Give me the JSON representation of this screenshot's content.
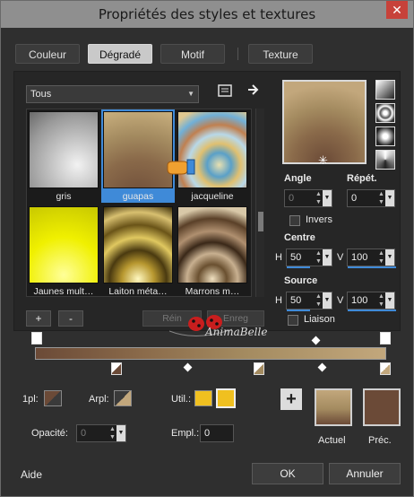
{
  "window": {
    "title": "Propriétés des styles et textures",
    "close_label": "✕"
  },
  "tabs": [
    {
      "label": "Couleur",
      "active": false
    },
    {
      "label": "Dégradé",
      "active": true
    },
    {
      "label": "Motif",
      "active": false
    },
    {
      "label": "Texture",
      "active": false
    }
  ],
  "category_select": {
    "value": "Tous"
  },
  "gallery": {
    "items": [
      {
        "label": "gris",
        "selected": false
      },
      {
        "label": "guapas",
        "selected": true
      },
      {
        "label": "jacqueline",
        "selected": false
      },
      {
        "label": "Jaunes mult…",
        "selected": false
      },
      {
        "label": "Laiton méta…",
        "selected": false
      },
      {
        "label": "Marrons m…",
        "selected": false
      }
    ]
  },
  "gallery_buttons": {
    "add": "+",
    "remove": "-",
    "reset": "Réin",
    "save": "Enreg"
  },
  "watermark": "AnimaBelle",
  "angle": {
    "label": "Angle",
    "value": "0"
  },
  "repeat": {
    "label": "Répét.",
    "value": "0"
  },
  "invert": {
    "label": "Invers",
    "checked": false
  },
  "center": {
    "label": "Centre",
    "h_label": "H",
    "h_value": "50",
    "v_label": "V",
    "v_value": "100"
  },
  "source": {
    "label": "Source",
    "h_label": "H",
    "h_value": "50",
    "v_label": "V",
    "v_value": "100"
  },
  "link": {
    "label": "Liaison",
    "checked": false
  },
  "stops_bar": {
    "plpl_label": "1pl:",
    "arpl_label": "Arpl:",
    "util_label": "Util.:",
    "opacity_label": "Opacité:",
    "opacity_value": "0",
    "empl_label": "Empl.:",
    "empl_value": "0"
  },
  "colors": {
    "current_label": "Actuel",
    "previous_label": "Préc.",
    "current_top": "#a48b60",
    "current_bottom": "#6b4a37",
    "previous": "#6b4a37",
    "accent": "#3f8ad8"
  },
  "footer": {
    "help": "Aide",
    "ok": "OK",
    "cancel": "Annuler"
  }
}
